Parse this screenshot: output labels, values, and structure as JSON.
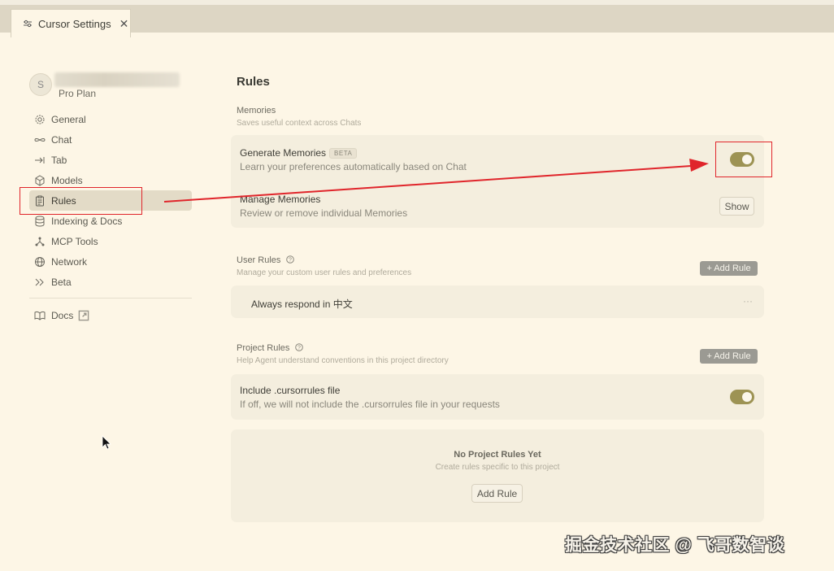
{
  "tab": {
    "title": "Cursor Settings",
    "close": "✕"
  },
  "profile": {
    "avatar_initial": "S",
    "plan": "Pro Plan"
  },
  "sidebar": {
    "items": [
      {
        "label": "General",
        "icon": "gear-icon"
      },
      {
        "label": "Chat",
        "icon": "infinity-icon"
      },
      {
        "label": "Tab",
        "icon": "tab-arrow-icon"
      },
      {
        "label": "Models",
        "icon": "cube-icon"
      },
      {
        "label": "Rules",
        "icon": "clipboard-icon",
        "active": true
      },
      {
        "label": "Indexing & Docs",
        "icon": "database-icon"
      },
      {
        "label": "MCP Tools",
        "icon": "nodes-icon"
      },
      {
        "label": "Network",
        "icon": "globe-icon"
      },
      {
        "label": "Beta",
        "icon": "double-chevron-icon"
      }
    ],
    "docs": {
      "label": "Docs",
      "icon": "book-icon"
    }
  },
  "main": {
    "title": "Rules",
    "memories": {
      "title": "Memories",
      "desc": "Saves useful context across Chats",
      "generate": {
        "title": "Generate Memories",
        "badge": "BETA",
        "desc": "Learn your preferences automatically based on Chat",
        "enabled": true
      },
      "manage": {
        "title": "Manage Memories",
        "desc": "Review or remove individual Memories",
        "button": "Show"
      }
    },
    "user_rules": {
      "title": "User Rules",
      "desc": "Manage your custom user rules and preferences",
      "add_button": "+ Add Rule",
      "rules": [
        {
          "text": "Always respond in 中文",
          "more": "···"
        }
      ]
    },
    "project_rules": {
      "title": "Project Rules",
      "desc": "Help Agent understand conventions in this project directory",
      "add_button": "+ Add Rule",
      "include": {
        "title": "Include .cursorrules file",
        "desc": "If off, we will not include the .cursorrules file in your requests",
        "enabled": true
      },
      "empty": {
        "title": "No Project Rules Yet",
        "desc": "Create rules specific to this project",
        "button": "Add Rule"
      }
    }
  },
  "annotation_color": "#E0252B",
  "accent_color": "#9D9354",
  "watermark": "掘金技术社区 @ 飞哥数智谈"
}
